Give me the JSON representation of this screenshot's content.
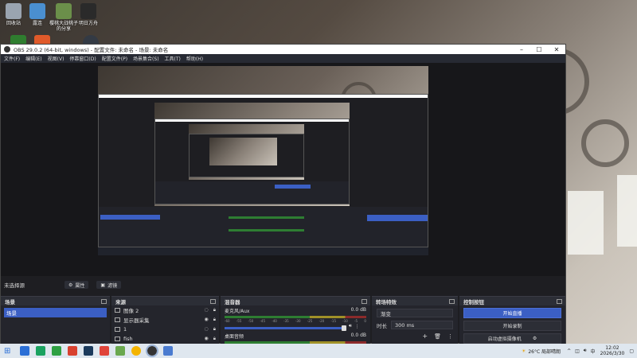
{
  "desktop": {
    "icons": [
      {
        "label": "回收站",
        "color": "#9aa4b0"
      },
      {
        "label": "露连",
        "color": "#4a8fd0"
      },
      {
        "label": "樱桃大战桃子 的分享",
        "color": "#6b8f4a"
      },
      {
        "label": "明日方舟",
        "color": "#2a2a2a"
      }
    ],
    "icons_row2_colors": [
      "#2f7d2f",
      "#e05a2a",
      "#333a44"
    ]
  },
  "obs": {
    "title": "OBS 29.0.2 (64-bit, windows) - 配置文件: 未命名 - 场景: 未命名",
    "window_buttons": [
      "–",
      "☐",
      "✕"
    ],
    "menu": [
      "文件(F)",
      "编辑(E)",
      "视图(V)",
      "停靠窗口(D)",
      "配置文件(P)",
      "场景集合(S)",
      "工具(T)",
      "帮助(H)"
    ],
    "status": {
      "no_source": "未选择源",
      "properties_label": "属性",
      "filters_label": "滤镜"
    },
    "scenes": {
      "title": "场景",
      "items": [
        "场景"
      ]
    },
    "sources": {
      "title": "来源",
      "items": [
        "图像 2",
        "显示器采集",
        "1",
        "fish"
      ]
    },
    "mixer": {
      "title": "混音器",
      "channels": [
        {
          "name": "麦克风/Aux",
          "db": "0.0 dB"
        },
        {
          "name": "桌面音频",
          "db": "0.0 dB"
        }
      ],
      "scale": [
        "-60",
        "-55",
        "-50",
        "-45",
        "-40",
        "-35",
        "-30",
        "-25",
        "-20",
        "-15",
        "-10",
        "-5",
        "0"
      ]
    },
    "transitions": {
      "title": "转场特效",
      "type": "渐变",
      "duration_label": "时长",
      "duration_value": "300 ms"
    },
    "controls": {
      "title": "控制按钮",
      "start_stream": "开始直播",
      "start_record": "开始录制",
      "virtual_cam": "启动虚拟摄像机"
    }
  },
  "taskbar": {
    "weather": "26°C 局部晴朗",
    "time": "12:02",
    "date": "2026/3/30",
    "app_colors": [
      "#2b6fd6",
      "#1aa260",
      "#2ea043",
      "#d8412f",
      "#1b3a5c",
      "#e0443a",
      "#6aa84f",
      "#f4b400",
      "#333333",
      "#4a7bd0"
    ]
  },
  "colors": {
    "accent": "#3b5fc4",
    "dock_bg": "#24252c",
    "window_bg": "#1e1e22"
  }
}
